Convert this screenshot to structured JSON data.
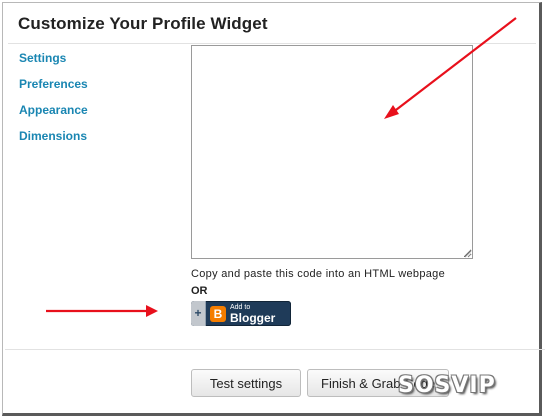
{
  "dialog": {
    "title": "Customize Your Profile Widget"
  },
  "nav": {
    "items": [
      {
        "label": "Settings"
      },
      {
        "label": "Preferences"
      },
      {
        "label": "Appearance"
      },
      {
        "label": "Dimensions"
      }
    ]
  },
  "code": {
    "value": "",
    "instructions": "Copy and paste this code into an HTML webpage",
    "or_label": "OR"
  },
  "blogger_button": {
    "plus": "+",
    "logo": "B",
    "small_text": "Add to",
    "big_text": "Blogger",
    "color": "#1f3b59",
    "logo_color": "#f57d00"
  },
  "footer": {
    "test_label": "Test settings",
    "finish_label": "Finish & Grab Code"
  },
  "watermark": "SOSVIP",
  "annotations": {
    "arrow_color": "#e8101c"
  },
  "colors": {
    "nav_link": "#1a86b2"
  }
}
